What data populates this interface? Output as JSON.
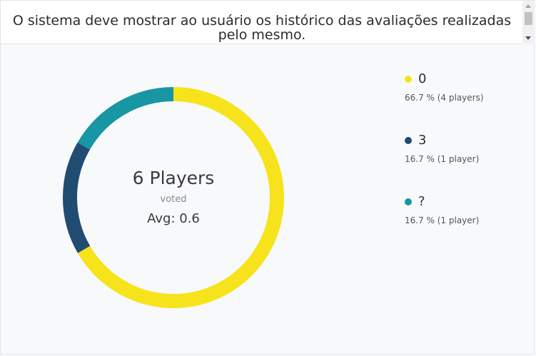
{
  "story": {
    "title_line1": "O sistema deve mostrar ao usuário os histórico das avaliações realizadas",
    "title_line2": "pelo mesmo."
  },
  "summary": {
    "players": "6 Players",
    "voted": "voted",
    "avg": "Avg: 0.6"
  },
  "colors": {
    "yellow": "#f7e31b",
    "navy": "#214c72",
    "teal": "#1996a3"
  },
  "chart_data": {
    "type": "pie",
    "categories": [
      "0",
      "3",
      "?"
    ],
    "values": [
      66.7,
      16.7,
      16.7
    ],
    "counts": [
      4,
      1,
      1
    ],
    "colors": [
      "#f7e31b",
      "#214c72",
      "#1996a3"
    ]
  },
  "legend": [
    {
      "label": "0",
      "detail": "66.7 % (4 players)",
      "color": "#f7e31b"
    },
    {
      "label": "3",
      "detail": "16.7 % (1 player)",
      "color": "#214c72"
    },
    {
      "label": "?",
      "detail": "16.7 % (1 player)",
      "color": "#1996a3"
    }
  ]
}
